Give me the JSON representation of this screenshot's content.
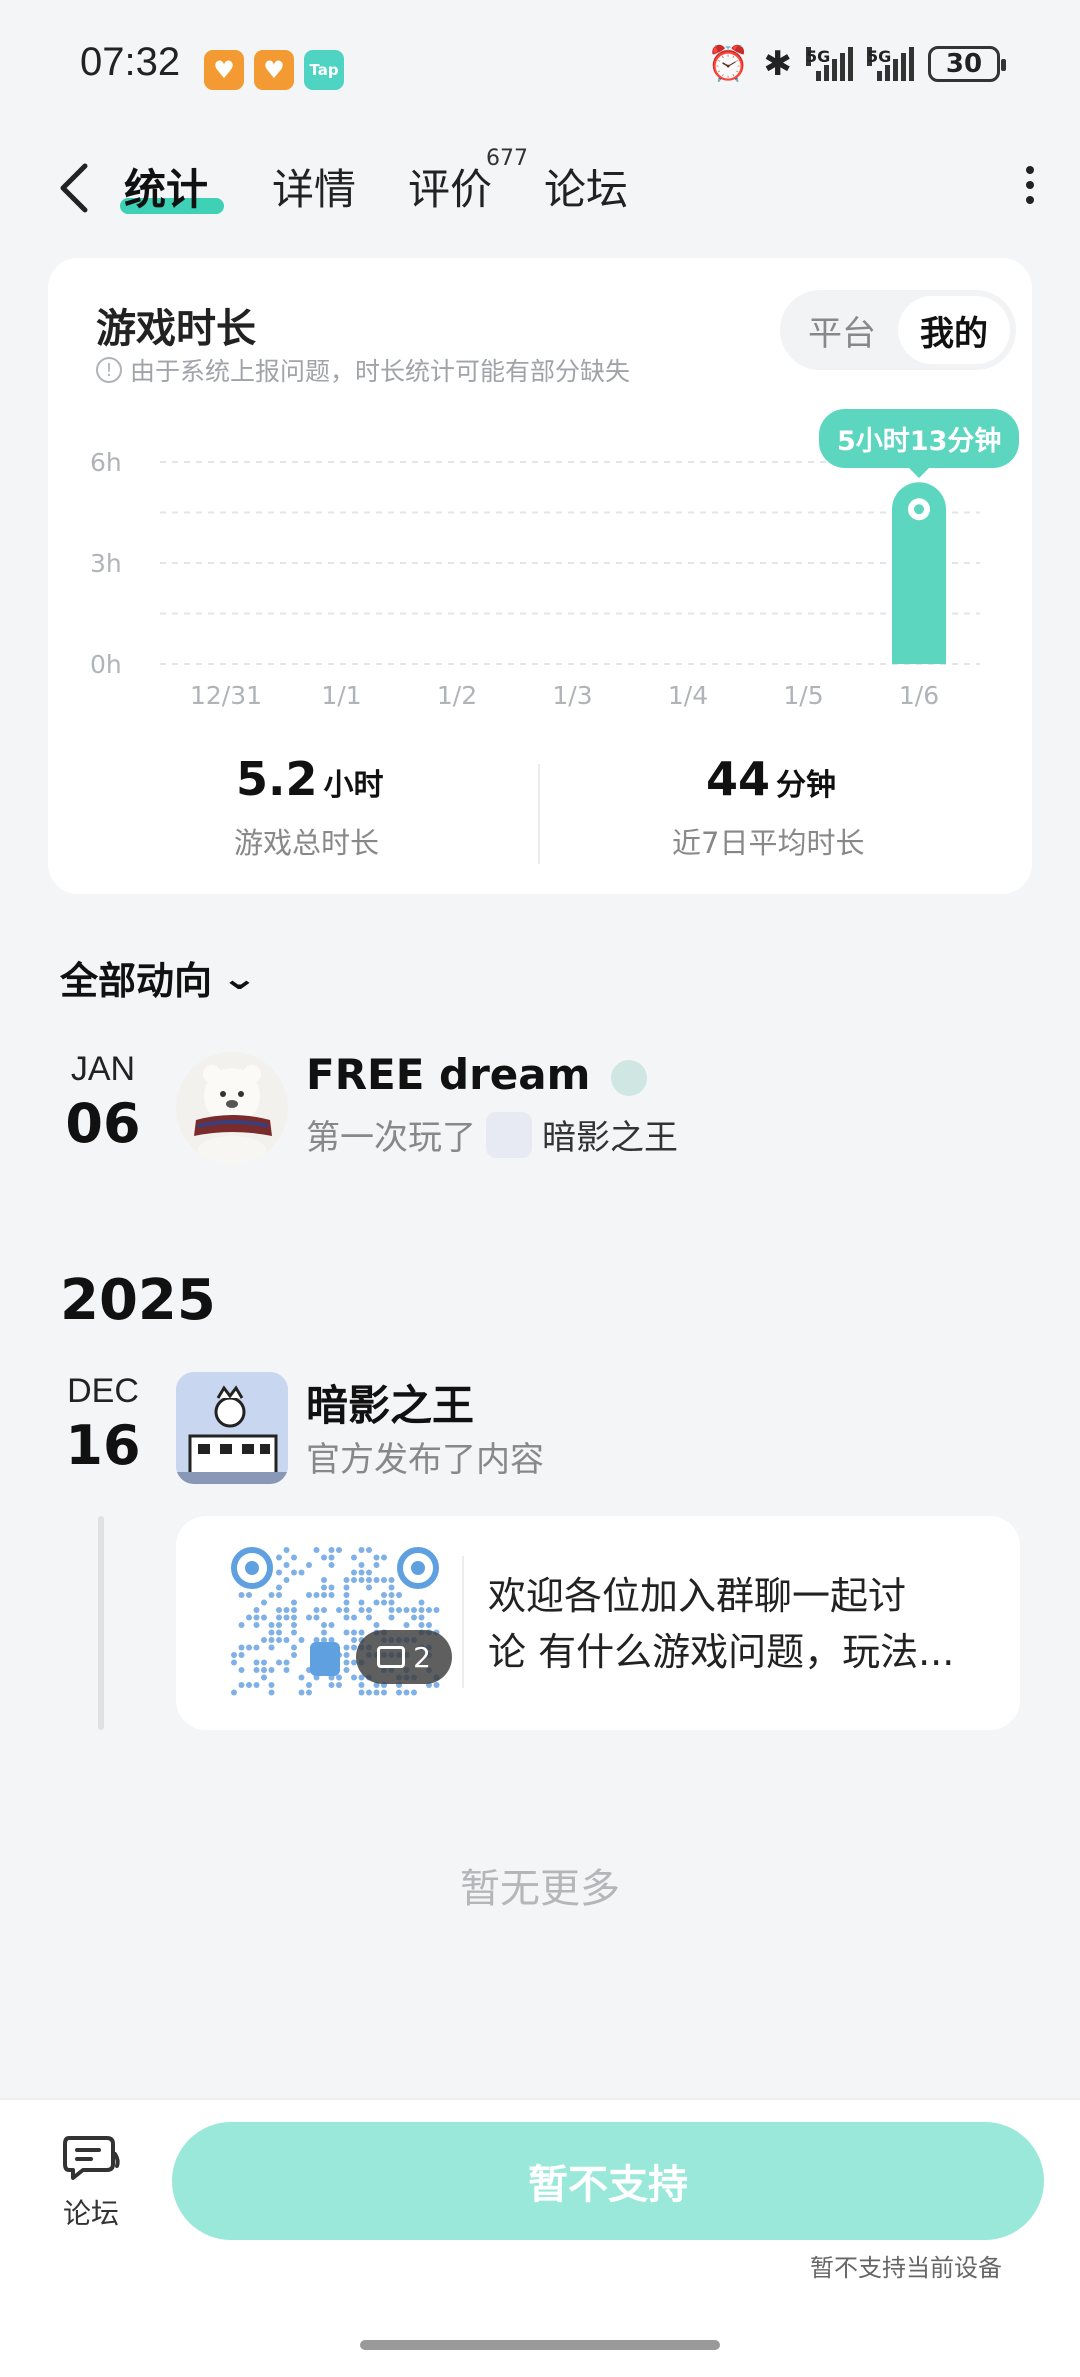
{
  "status_bar": {
    "time": "07:32",
    "app_badges": [
      "",
      "",
      "Tap"
    ],
    "signal_labels": [
      "5G",
      "5G"
    ],
    "battery": "30"
  },
  "nav": {
    "tabs": [
      {
        "label": "统计",
        "active": true
      },
      {
        "label": "详情",
        "active": false
      },
      {
        "label": "评价",
        "active": false
      },
      {
        "label": "论坛",
        "active": false
      }
    ],
    "review_count": "677"
  },
  "playtime_card": {
    "title": "游戏时长",
    "note": "由于系统上报问题，时长统计可能有部分缺失",
    "segment": {
      "options": [
        "平台",
        "我的"
      ],
      "selected": "我的"
    },
    "stats": [
      {
        "value": "5.2",
        "unit": "小时",
        "label": "游戏总时长"
      },
      {
        "value": "44",
        "unit": "分钟",
        "label": "近7日平均时长"
      }
    ]
  },
  "chart_data": {
    "type": "bar",
    "categories": [
      "12/31",
      "1/1",
      "1/2",
      "1/3",
      "1/4",
      "1/5",
      "1/6"
    ],
    "values": [
      0,
      0,
      0,
      0,
      0,
      0,
      5.22
    ],
    "yticks": [
      "0h",
      "3h",
      "6h"
    ],
    "ylim": [
      0,
      6
    ],
    "grid": true,
    "highlight_label": "5小时13分钟",
    "color": "#5dd6c0"
  },
  "activity": {
    "filter_label": "全部动向",
    "items": [
      {
        "month": "JAN",
        "day": "06",
        "name": "FREE dream",
        "action": "第一次玩了",
        "game": "暗影之王"
      }
    ],
    "year": "2025",
    "items_2025": [
      {
        "month": "DEC",
        "day": "16",
        "name": "暗影之王",
        "action": "官方发布了内容",
        "post": {
          "line1": "欢迎各位加入群聊一起讨",
          "line2": "论 有什么游戏问题，玩法...",
          "image_count": "2"
        }
      }
    ],
    "end_text": "暂无更多"
  },
  "bottom": {
    "forum_label": "论坛",
    "main_button": "暂不支持",
    "hint": "暂不支持当前设备"
  },
  "colors": {
    "accent": "#3ed1b5",
    "button": "#9ae8da",
    "background": "#f4f5f7"
  }
}
